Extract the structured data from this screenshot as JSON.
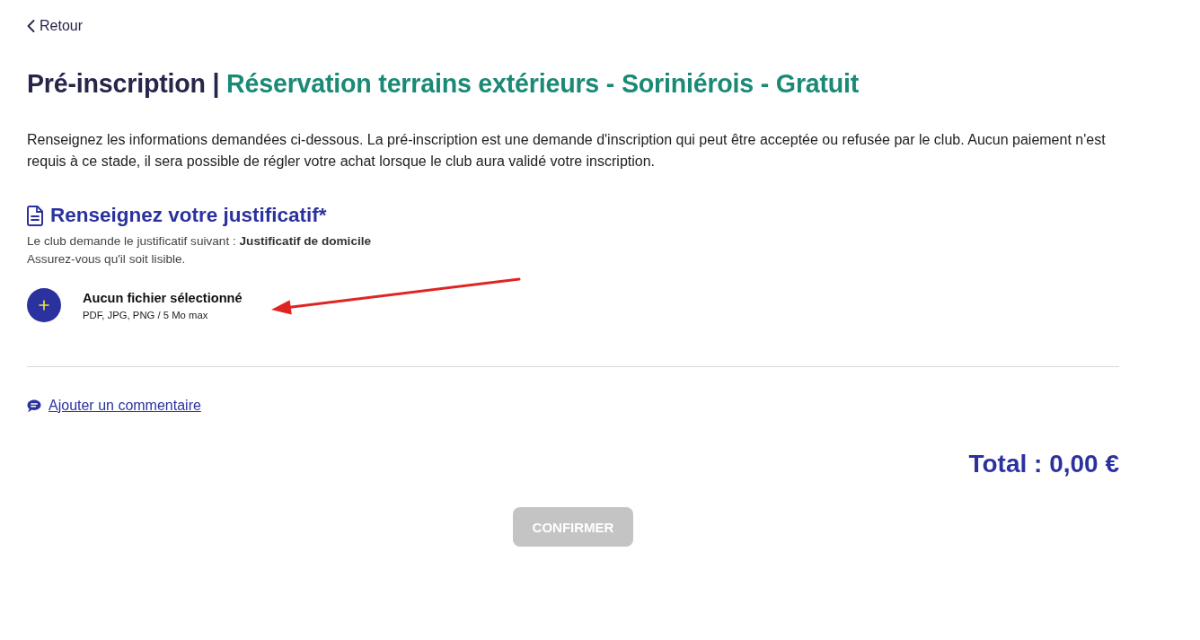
{
  "back_link": {
    "label": "Retour"
  },
  "title": {
    "prefix": "Pré-inscription",
    "separator": "|",
    "activity": "Réservation terrains extérieurs - Soriniérois - Gratuit"
  },
  "intro": "Renseignez les informations demandées ci-dessous. La pré-inscription est une demande d'inscription qui peut être acceptée ou refusée par le club. Aucun paiement n'est requis à ce stade, il sera possible de régler votre achat lorsque le club aura validé votre inscription.",
  "document_section": {
    "heading": "Renseignez votre justificatif*",
    "request": "Le club demande le justificatif suivant : **Justificatif de domicile**",
    "note": "Assurez-vous qu'il soit lisible.",
    "upload": {
      "status": "Aucun fichier sélectionné",
      "hint": "PDF, JPG, PNG / 5 Mo max"
    }
  },
  "comment_link": {
    "label": "Ajouter un commentaire"
  },
  "total": "Total : 0,00 €",
  "confirm_button": {
    "label": "CONFIRMER",
    "disabled": true
  }
}
